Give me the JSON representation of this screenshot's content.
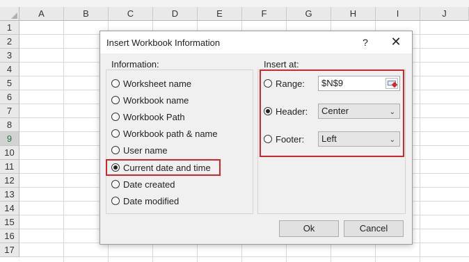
{
  "sheet": {
    "columns": [
      "A",
      "B",
      "C",
      "D",
      "E",
      "F",
      "G",
      "H",
      "I",
      "J"
    ],
    "rows": [
      "1",
      "2",
      "3",
      "4",
      "5",
      "6",
      "7",
      "8",
      "9",
      "10",
      "11",
      "12",
      "13",
      "14",
      "15",
      "16",
      "17"
    ],
    "selected_row": "9"
  },
  "dialog": {
    "title": "Insert Workbook Information",
    "help_label": "?",
    "close_label": "✕",
    "information": {
      "label": "Information:",
      "options": [
        {
          "label": "Worksheet name",
          "checked": false
        },
        {
          "label": "Workbook name",
          "checked": false
        },
        {
          "label": "Workbook Path",
          "checked": false
        },
        {
          "label": "Workbook path & name",
          "checked": false
        },
        {
          "label": "User name",
          "checked": false
        },
        {
          "label": "Current date and time",
          "checked": true
        },
        {
          "label": "Date created",
          "checked": false
        },
        {
          "label": "Date modified",
          "checked": false
        }
      ]
    },
    "insert_at": {
      "label": "Insert at:",
      "range": {
        "label": "Range:",
        "value": "$N$9",
        "checked": false
      },
      "header": {
        "label": "Header:",
        "value": "Center",
        "checked": true
      },
      "footer": {
        "label": "Footer:",
        "value": "Left",
        "checked": false
      }
    },
    "ok_label": "Ok",
    "cancel_label": "Cancel"
  },
  "colors": {
    "highlight": "#d4252b",
    "dialog_bg": "#f0f0f0",
    "selected_row_text": "#217346"
  }
}
